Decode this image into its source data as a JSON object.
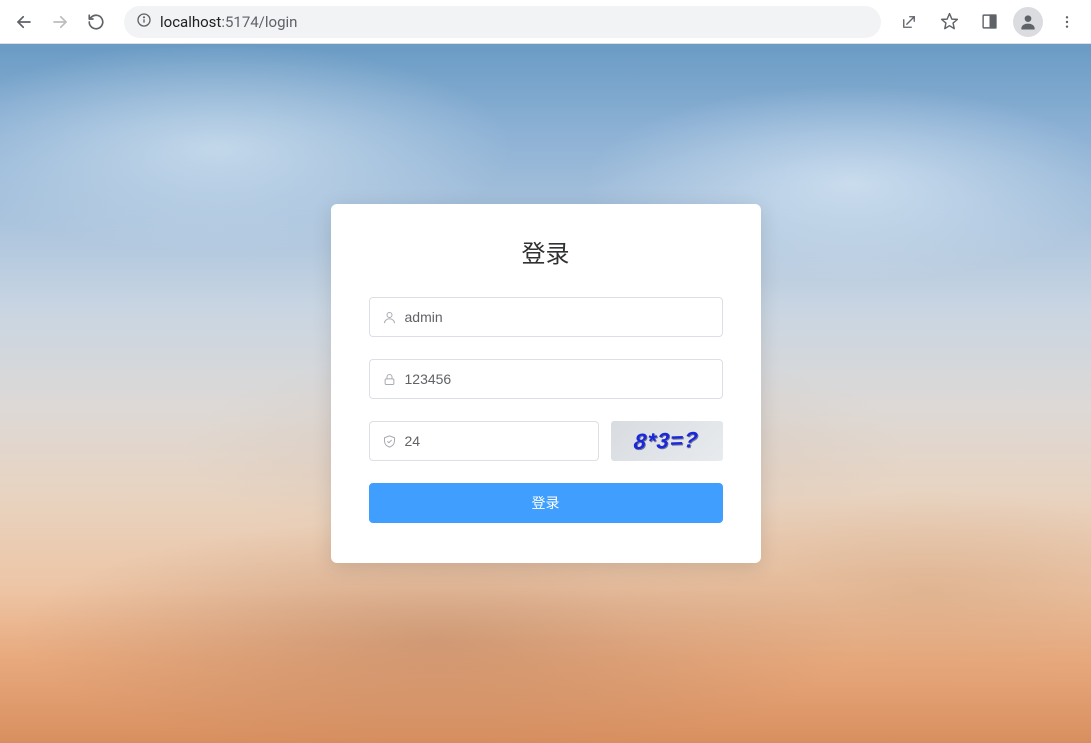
{
  "browser": {
    "url_host": "localhost",
    "url_port_path": ":5174/login"
  },
  "login": {
    "title": "登录",
    "username_value": "admin",
    "password_value": "123456",
    "captcha_value": "24",
    "captcha_question": "8*3=?",
    "submit_label": "登录"
  }
}
